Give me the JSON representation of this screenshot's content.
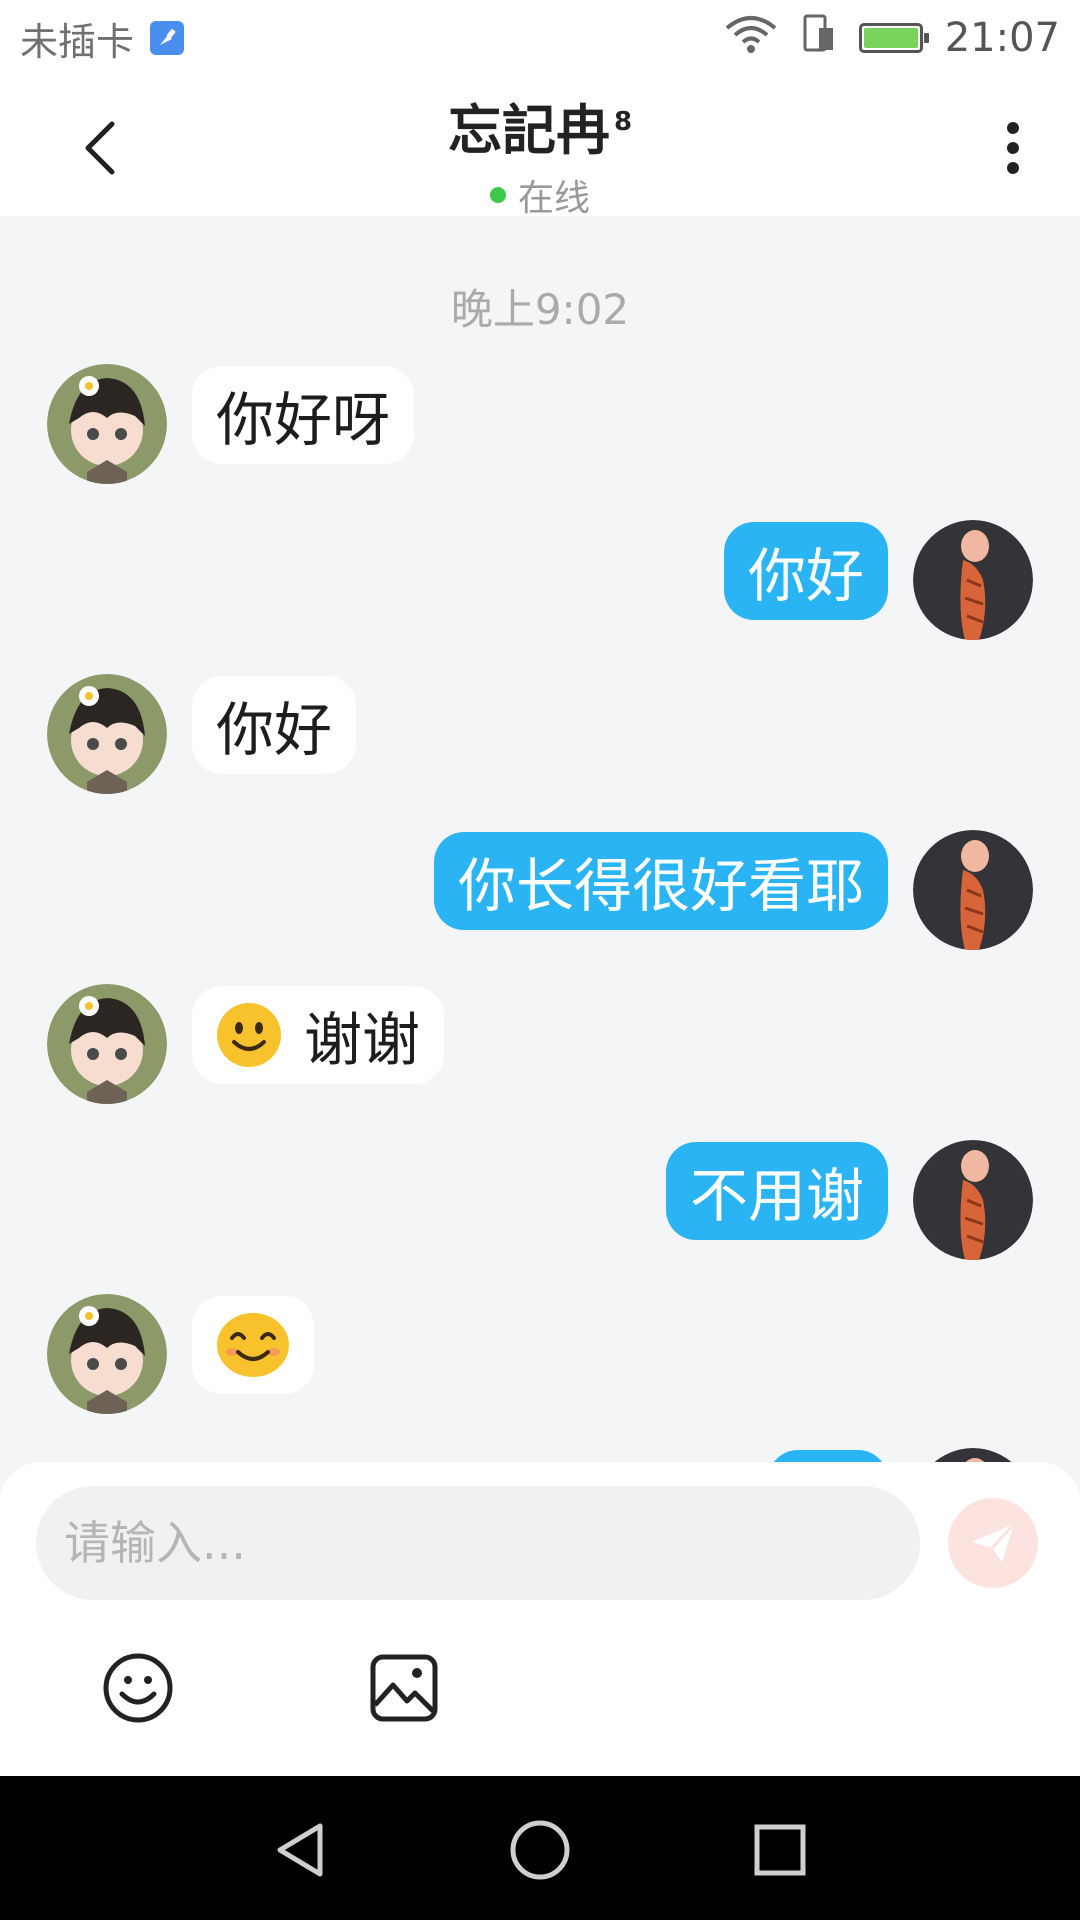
{
  "status_bar": {
    "carrier": "未插卡",
    "time": "21:07",
    "icons": [
      "app-cleaner-icon",
      "wifi-icon",
      "sim-data-icon",
      "battery-charging-icon"
    ]
  },
  "header": {
    "title": "忘記冉",
    "title_superscript": "8",
    "status": "在线",
    "status_color": "#3cc94b",
    "back_icon": "chevron-left-icon",
    "menu_icon": "more-vertical-icon"
  },
  "chat": {
    "time_label": "晚上9:02",
    "colors": {
      "incoming_bg": "#ffffff",
      "outgoing_bg": "#2ab4f4"
    },
    "messages": [
      {
        "side": "left",
        "text": "你好呀"
      },
      {
        "side": "right",
        "text": "你好"
      },
      {
        "side": "left",
        "text": "你好"
      },
      {
        "side": "right",
        "text": "你长得很好看耶"
      },
      {
        "side": "left",
        "text": "谢谢",
        "emoji": "slightly-smiling-face"
      },
      {
        "side": "right",
        "text": "不用谢"
      },
      {
        "side": "left",
        "text": "",
        "emoji": "smiling-face-with-smiling-eyes"
      }
    ]
  },
  "input": {
    "placeholder": "请输入...",
    "value": "",
    "send_icon": "paper-plane-icon",
    "tools": [
      "emoji-icon",
      "image-icon"
    ]
  },
  "nav_bar": {
    "buttons": [
      "back-triangle-icon",
      "home-circle-icon",
      "recents-square-icon"
    ]
  }
}
